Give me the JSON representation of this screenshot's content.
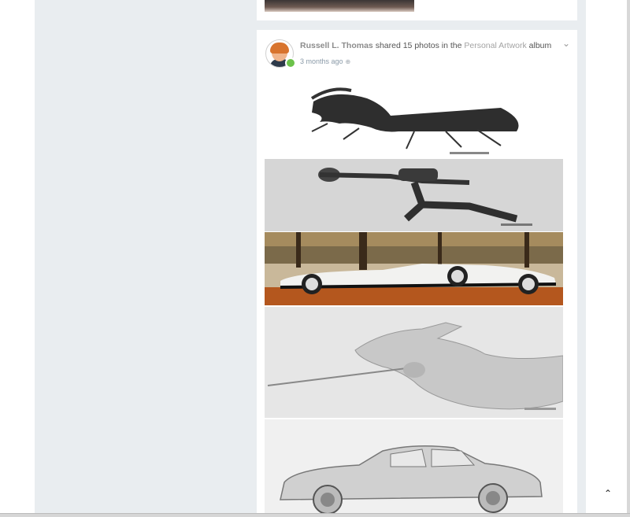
{
  "post": {
    "author": "Russell L. Thomas",
    "action_prefix": " shared 15 photos in the ",
    "album": "Personal Artwork",
    "action_suffix": " album",
    "time": "3 months ago"
  },
  "photos": [
    {
      "name": "beetle-drawing"
    },
    {
      "name": "martial-artist-drawing"
    },
    {
      "name": "classic-car-painting"
    },
    {
      "name": "dragon-sword-drawing"
    },
    {
      "name": "vintage-car-sketch"
    }
  ],
  "icons": {
    "privacy": "globe-icon",
    "options": "chevron-down-icon",
    "scroll_top": "chevron-up-icon"
  },
  "colors": {
    "page_bg": "#e9edf0",
    "card_bg": "#ffffff",
    "online": "#6cc24a"
  }
}
